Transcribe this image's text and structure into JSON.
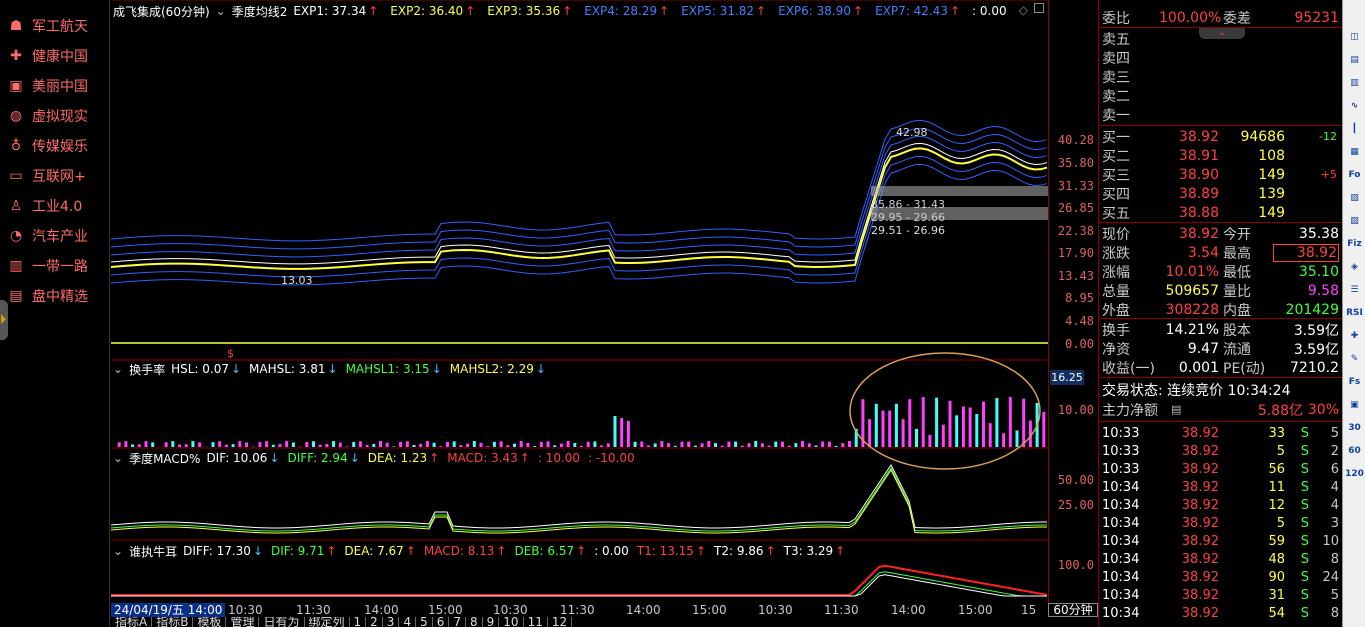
{
  "left_panel": {
    "items": [
      {
        "label": "军工航天",
        "icon": "bear-icon"
      },
      {
        "label": "健康中国",
        "icon": "cross-icon"
      },
      {
        "label": "美丽中国",
        "icon": "briefcase-icon"
      },
      {
        "label": "虚拟现实",
        "icon": "vr-globe-icon"
      },
      {
        "label": "传媒娱乐",
        "icon": "money-bag-icon"
      },
      {
        "label": "互联网+",
        "icon": "browser-icon"
      },
      {
        "label": "工业4.0",
        "icon": "worker-icon"
      },
      {
        "label": "汽车产业",
        "icon": "pie-icon"
      },
      {
        "label": "一带一路",
        "icon": "bars-icon"
      },
      {
        "label": "盘中精选",
        "icon": "folder-icon"
      }
    ]
  },
  "main_panel": {
    "stock_name": "成飞集成(60分钟)",
    "indicator": "季度均线2",
    "values": [
      {
        "label": "EXP1: 37.34",
        "arrow": "↑",
        "color": "#ffffff"
      },
      {
        "label": "EXP2: 36.40",
        "arrow": "↑",
        "color": "#ffff40"
      },
      {
        "label": "EXP3: 35.36",
        "arrow": "↑",
        "color": "#ffff40"
      },
      {
        "label": "EXP4: 28.29",
        "arrow": "↑",
        "color": "#4080ff"
      },
      {
        "label": "EXP5: 31.82",
        "arrow": "↑",
        "color": "#4080ff"
      },
      {
        "label": "EXP6: 38.90",
        "arrow": "↑",
        "color": "#4080ff"
      },
      {
        "label": "EXP7: 42.43",
        "arrow": "↑",
        "color": "#4080ff"
      },
      {
        "label": ": 0.00",
        "arrow": "",
        "color": "#ffffff"
      }
    ],
    "annotations": {
      "high": "42.98",
      "low": "13.03",
      "zone1": "35.86 - 31.43",
      "zone2": "29.95 - 29.66",
      "zone3": "29.51 - 26.96"
    },
    "y_ticks": [
      "40.28",
      "35.80",
      "31.33",
      "26.85",
      "22.38",
      "17.90",
      "13.43",
      "8.95",
      "4.48",
      "0.00"
    ]
  },
  "turnover_panel": {
    "name": "换手率",
    "values": [
      {
        "label": "HSL: 0.07",
        "arrow": "↓",
        "color": "#ffffff"
      },
      {
        "label": "MAHSL: 3.81",
        "arrow": "↓",
        "color": "#ffffff"
      },
      {
        "label": "MAHSL1: 3.15",
        "arrow": "↓",
        "color": "#40ff40"
      },
      {
        "label": "MAHSL2: 2.29",
        "arrow": "↓",
        "color": "#ffff40"
      }
    ],
    "badge": "16.25",
    "y_ticks": [
      "10.00"
    ]
  },
  "macd_panel": {
    "name": "季度MACD%",
    "values": [
      {
        "label": "DIF: 10.06",
        "arrow": "↓",
        "color": "#ffffff"
      },
      {
        "label": "DIFF: 2.94",
        "arrow": "↓",
        "color": "#40ff40"
      },
      {
        "label": "DEA: 1.23",
        "arrow": "↑",
        "color": "#ffff40"
      },
      {
        "label": "MACD: 3.43",
        "arrow": "↑",
        "color": "#ff4040"
      },
      {
        "label": ": 10.00",
        "arrow": "",
        "color": "#ff4040"
      },
      {
        "label": ": -10.00",
        "arrow": "",
        "color": "#ff4040"
      }
    ],
    "y_ticks": [
      "50.00",
      "25.00"
    ]
  },
  "bull_panel": {
    "name": "谁执牛耳",
    "values": [
      {
        "label": "DIFF: 17.30",
        "arrow": "↓",
        "color": "#ffffff"
      },
      {
        "label": "DIF: 9.71",
        "arrow": "↑",
        "color": "#40ff40"
      },
      {
        "label": "DEA: 7.67",
        "arrow": "↑",
        "color": "#ffff40"
      },
      {
        "label": "MACD: 8.13",
        "arrow": "↑",
        "color": "#ff4040"
      },
      {
        "label": "DEB: 6.57",
        "arrow": "↑",
        "color": "#40ff40"
      },
      {
        "label": ": 0.00",
        "arrow": "",
        "color": "#ffffff"
      },
      {
        "label": "T1: 13.15",
        "arrow": "↑",
        "color": "#ff4040"
      },
      {
        "label": "T2: 9.86",
        "arrow": "↑",
        "color": "#ffffff"
      },
      {
        "label": "T3: 3.29",
        "arrow": "↑",
        "color": "#ffffff"
      }
    ],
    "y_ticks": [
      "100.0"
    ]
  },
  "time_axis": {
    "date": "24/04/19/五 14:00",
    "labels": [
      "10:30",
      "11:30",
      "14:00",
      "15:00",
      "10:30",
      "11:30",
      "14:00",
      "15:00",
      "10:30",
      "11:30",
      "14:00",
      "15:00",
      "15"
    ],
    "period": "60分钟"
  },
  "bottom_tabs": [
    "指标A",
    "指标B",
    "模板",
    "管理",
    "日有为",
    "绑定列",
    "1",
    "2",
    "3",
    "4",
    "5",
    "6",
    "7",
    "8",
    "9",
    "10",
    "11",
    "12"
  ],
  "quote": {
    "weibi_label": "委比",
    "weibi_value": "100.00%",
    "weicha_label": "委差",
    "weicha_value": "95231",
    "sell": [
      {
        "label": "卖五"
      },
      {
        "label": "卖四"
      },
      {
        "label": "卖三"
      },
      {
        "label": "卖二"
      },
      {
        "label": "卖一"
      }
    ],
    "buy": [
      {
        "label": "买一",
        "price": "38.92",
        "vol": "94686",
        "chg": "-12"
      },
      {
        "label": "买二",
        "price": "38.91",
        "vol": "108",
        "chg": ""
      },
      {
        "label": "买三",
        "price": "38.90",
        "vol": "149",
        "chg": "+5"
      },
      {
        "label": "买四",
        "price": "38.89",
        "vol": "139",
        "chg": ""
      },
      {
        "label": "买五",
        "price": "38.88",
        "vol": "149",
        "chg": ""
      }
    ],
    "stats": [
      {
        "l1": "现价",
        "v1": "38.92",
        "c1": "#ff4040",
        "l2": "今开",
        "v2": "35.38",
        "c2": "#ffffff"
      },
      {
        "l1": "涨跌",
        "v1": "3.54",
        "c1": "#ff4040",
        "l2": "最高",
        "v2": "38.92",
        "c2": "#ff4040"
      },
      {
        "l1": "涨幅",
        "v1": "10.01%",
        "c1": "#ff4040",
        "l2": "最低",
        "v2": "35.10",
        "c2": "#40ff40"
      },
      {
        "l1": "总量",
        "v1": "509657",
        "c1": "#ffff40",
        "l2": "量比",
        "v2": "9.58",
        "c2": "#ff40ff"
      },
      {
        "l1": "外盘",
        "v1": "308228",
        "c1": "#ff4040",
        "l2": "内盘",
        "v2": "201429",
        "c2": "#40ff40"
      }
    ],
    "stats2": [
      {
        "l1": "换手",
        "v1": "14.21%",
        "l2": "股本",
        "v2": "3.59亿"
      },
      {
        "l1": "净资",
        "v1": "9.47",
        "l2": "流通",
        "v2": "3.59亿"
      },
      {
        "l1": "收益(一)",
        "v1": "0.001",
        "l2": "PE(动)",
        "v2": "7210.2"
      }
    ],
    "trade_status": "交易状态: 连续竞价 10:34:24",
    "net_label": "主力净额",
    "net_value": "5.88亿",
    "net_pct": "30%",
    "ticks": [
      {
        "time": "10:33",
        "price": "38.92",
        "vol": "33",
        "side": "S",
        "n": "5"
      },
      {
        "time": "10:33",
        "price": "38.92",
        "vol": "5",
        "side": "S",
        "n": "2"
      },
      {
        "time": "10:33",
        "price": "38.92",
        "vol": "56",
        "side": "S",
        "n": "6"
      },
      {
        "time": "10:34",
        "price": "38.92",
        "vol": "11",
        "side": "S",
        "n": "4"
      },
      {
        "time": "10:34",
        "price": "38.92",
        "vol": "12",
        "side": "S",
        "n": "4"
      },
      {
        "time": "10:34",
        "price": "38.92",
        "vol": "5",
        "side": "S",
        "n": "3"
      },
      {
        "time": "10:34",
        "price": "38.92",
        "vol": "59",
        "side": "S",
        "n": "10"
      },
      {
        "time": "10:34",
        "price": "38.92",
        "vol": "48",
        "side": "S",
        "n": "8"
      },
      {
        "time": "10:34",
        "price": "38.92",
        "vol": "90",
        "side": "S",
        "n": "24"
      },
      {
        "time": "10:34",
        "price": "38.92",
        "vol": "31",
        "side": "S",
        "n": "5"
      },
      {
        "time": "10:34",
        "price": "38.92",
        "vol": "54",
        "side": "S",
        "n": "8"
      }
    ]
  },
  "right_toolbar": [
    "◫",
    "▤",
    "▥",
    "∿",
    "┃",
    "▦",
    "Fo",
    "▧",
    "▨",
    "Fiz",
    "◈",
    "☰",
    "RSI",
    "✚",
    "✎",
    "Fs",
    "▣",
    "30",
    "60",
    "120"
  ]
}
